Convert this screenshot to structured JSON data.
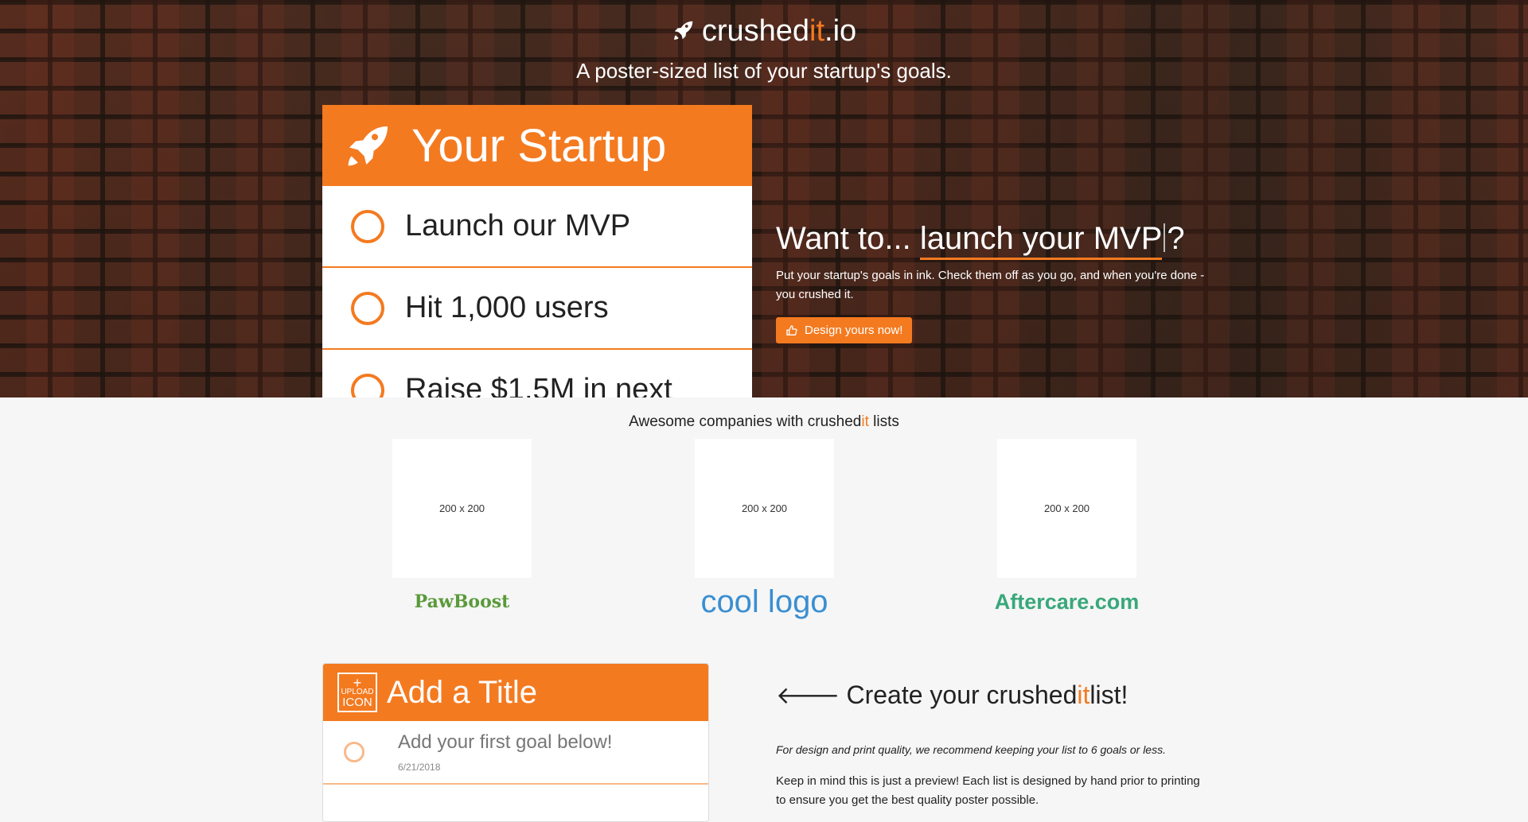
{
  "brand": {
    "prefix": "crushed",
    "accent": "it",
    "suffix": ".io",
    "icon": "rocket-icon"
  },
  "tagline": "A poster-sized list of your startup's goals.",
  "poster": {
    "title": "Your Startup",
    "items": [
      "Launch our MVP",
      "Hit 1,000 users",
      "Raise $1.5M in next"
    ]
  },
  "pitch": {
    "prefix": "Want to... ",
    "typed": "launch your MVP",
    "suffix": "?",
    "body": "Put your startup's goals in ink. Check them off as you go, and when you're done - you crushed it.",
    "cta": "Design yours now!"
  },
  "companies": {
    "title_prefix": "Awesome companies with crushed",
    "title_accent": "it",
    "title_suffix": " lists",
    "items": [
      {
        "placeholder": "200 x 200",
        "logo": "PawBoost"
      },
      {
        "placeholder": "200 x 200",
        "logo": "cool logo"
      },
      {
        "placeholder": "200 x 200",
        "logo": "Aftercare.com"
      }
    ]
  },
  "builder": {
    "upload_plus": "+",
    "upload_small": "UPLOAD",
    "upload_big": "ICON",
    "title": "Add a Title",
    "first_goal": "Add your first goal below!",
    "date": "6/21/2018"
  },
  "create": {
    "arrow": "🡐",
    "prefix": "Create your crushed",
    "accent": "it",
    "suffix": " list!",
    "note": "For design and print quality, we recommend keeping your list to 6 goals or less.",
    "preview": "Keep in mind this is just a preview! Each list is designed by hand prior to printing to ensure you get the best quality poster possible."
  },
  "colors": {
    "accent": "#f47a20",
    "background": "#f6f6f6"
  }
}
